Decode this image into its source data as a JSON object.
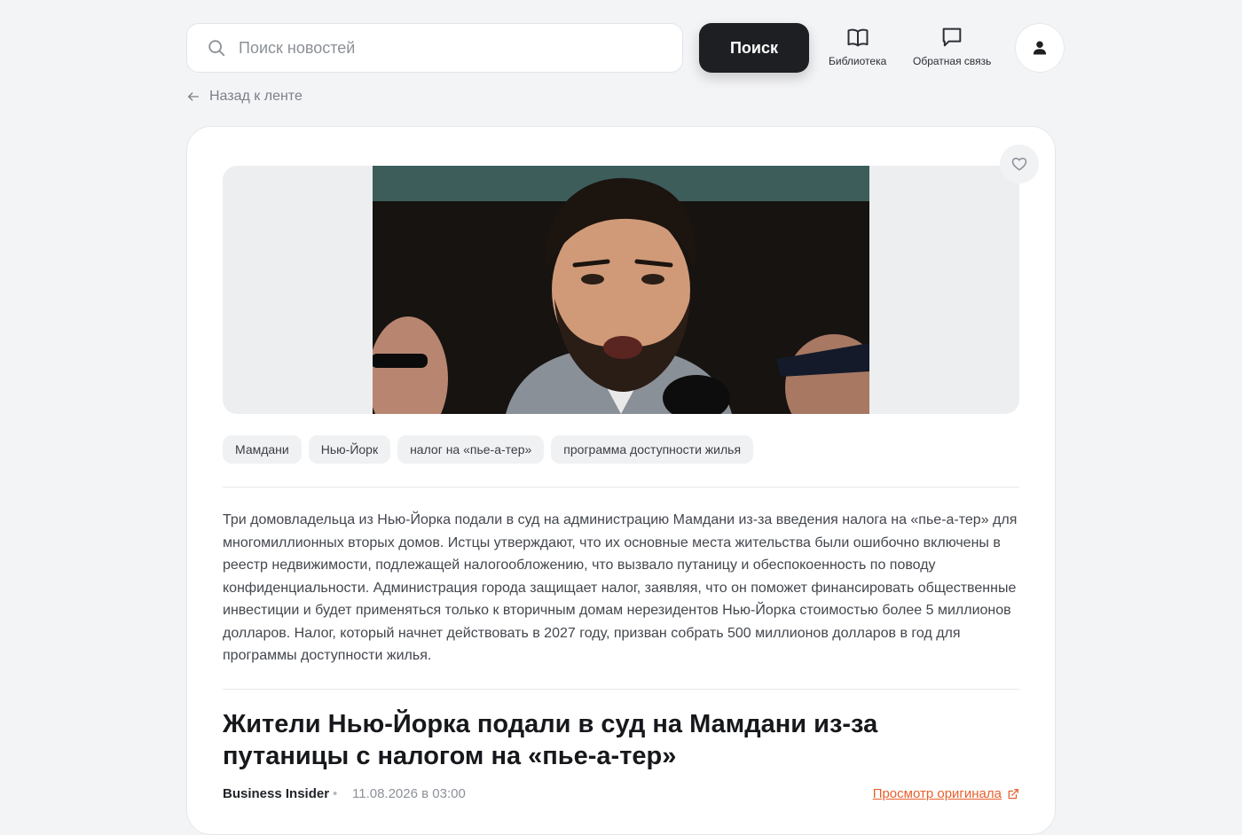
{
  "search": {
    "placeholder": "Поиск новостей",
    "button_label": "Поиск"
  },
  "nav": {
    "library_label": "Библиотека",
    "feedback_label": "Обратная связь"
  },
  "back_link": "Назад к ленте",
  "article": {
    "tags": [
      "Мамдани",
      "Нью-Йорк",
      "налог на «пье-а-тер»",
      "программа доступности жилья"
    ],
    "summary": "Три домовладельца из Нью-Йорка подали в суд на администрацию Мамдани из-за введения налога на «пье-а-тер» для многомиллионных вторых домов. Истцы утверждают, что их основные места жительства были ошибочно включены в реестр недвижимости, подлежащей налогообложению, что вызвало путаницу и обеспокоенность по поводу конфиденциальности. Администрация города защищает налог, заявляя, что он поможет финансировать общественные инвестиции и будет применяться только к вторичным домам нерезидентов Нью-Йорка стоимостью более 5 миллионов долларов. Налог, который начнет действовать в 2027 году, призван собрать 500 миллионов долларов в год для программы доступности жилья.",
    "headline": "Жители Нью-Йорка подали в суд на Мамдани из-за путаницы с налогом на «пье-а-тер»",
    "source": "Business Insider",
    "separator": "•",
    "date": "11.08.2026 в 03:00",
    "original_link": "Просмотр оригинала"
  },
  "colors": {
    "accent": "#e8602c",
    "button_dark": "#1d1f22",
    "background": "#f3f4f6"
  }
}
